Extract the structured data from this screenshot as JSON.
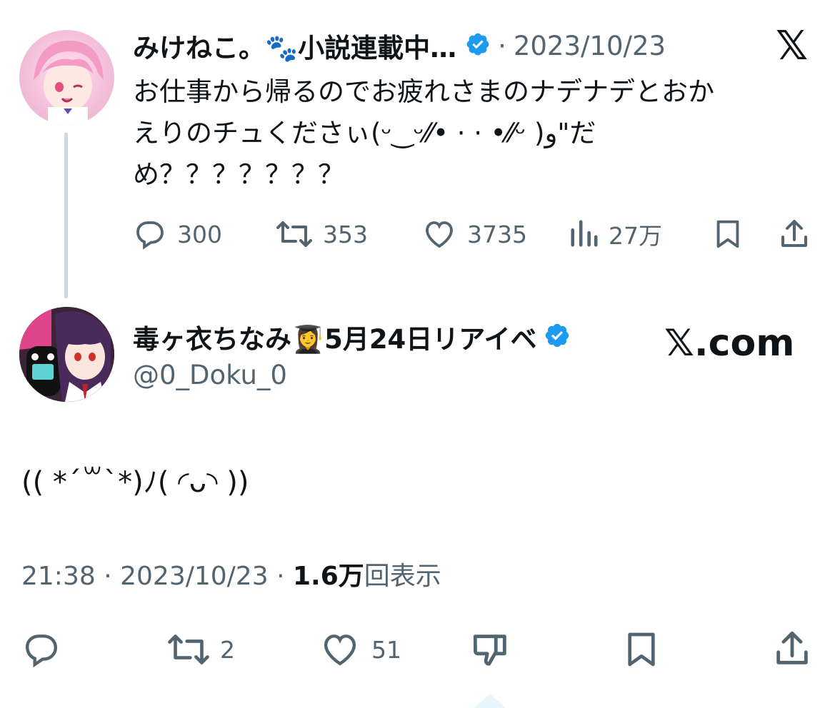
{
  "colors": {
    "accent": "#1d9bf0",
    "secondary_text": "#536471",
    "thread_line": "#cfd9de"
  },
  "tweet1": {
    "author_name": "みけねこ。🐾小説連載中…",
    "separator": "·",
    "date": "2023/10/23",
    "text_line1": "お仕事から帰るのでお疲れさまのナデナデとおか",
    "text_line2": "えりのチュくださぃ(ᵕ‿ᵕ⁄⁄• · · •⁄⁄ᵕ )و\"だ",
    "text_line3": "め？？？？？？？",
    "replies": "300",
    "retweets": "353",
    "likes": "3735",
    "views": "27万"
  },
  "tweet2": {
    "author_name": "毒ヶ衣ちなみ👩‍🎓5月24日リアイベ",
    "handle": "@0_Doku_0",
    "text": "(( *´꒳`*)ﾉ( ◜ᴗ◝ ))",
    "time": "21:38",
    "sep1": "·",
    "date": "2023/10/23",
    "sep2": "·",
    "views_count": "1.6万",
    "views_label": "回表示",
    "retweets": "2",
    "likes": "51"
  },
  "branding": {
    "x_logo": "𝕏",
    "x_com": "𝕏.com"
  }
}
